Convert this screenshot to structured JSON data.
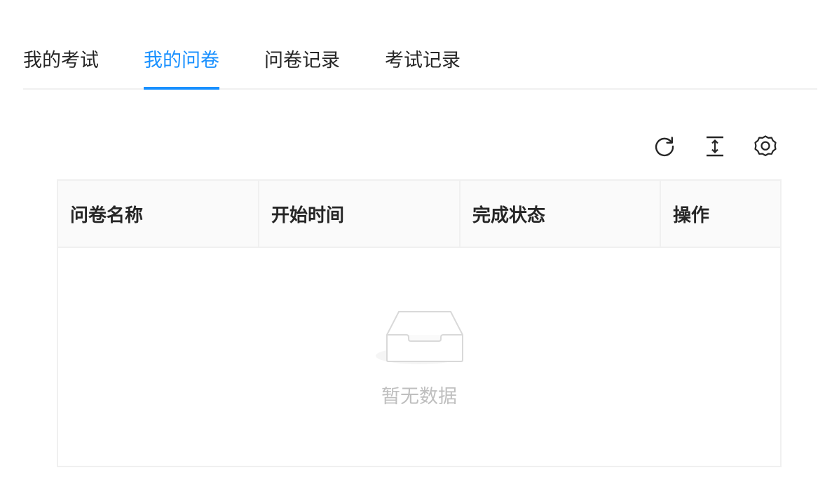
{
  "tabs": [
    {
      "label": "我的考试",
      "active": false
    },
    {
      "label": "我的问卷",
      "active": true
    },
    {
      "label": "问卷记录",
      "active": false
    },
    {
      "label": "考试记录",
      "active": false
    }
  ],
  "toolbar": {
    "icons": [
      "reload-icon",
      "column-height-icon",
      "setting-icon"
    ]
  },
  "table": {
    "columns": [
      "问卷名称",
      "开始时间",
      "完成状态",
      "操作"
    ],
    "empty_text": "暂无数据"
  },
  "colors": {
    "accent": "#1890ff",
    "border": "#f0f0f0",
    "header_bg": "#fafafa",
    "empty_text": "#bfbfbf"
  }
}
